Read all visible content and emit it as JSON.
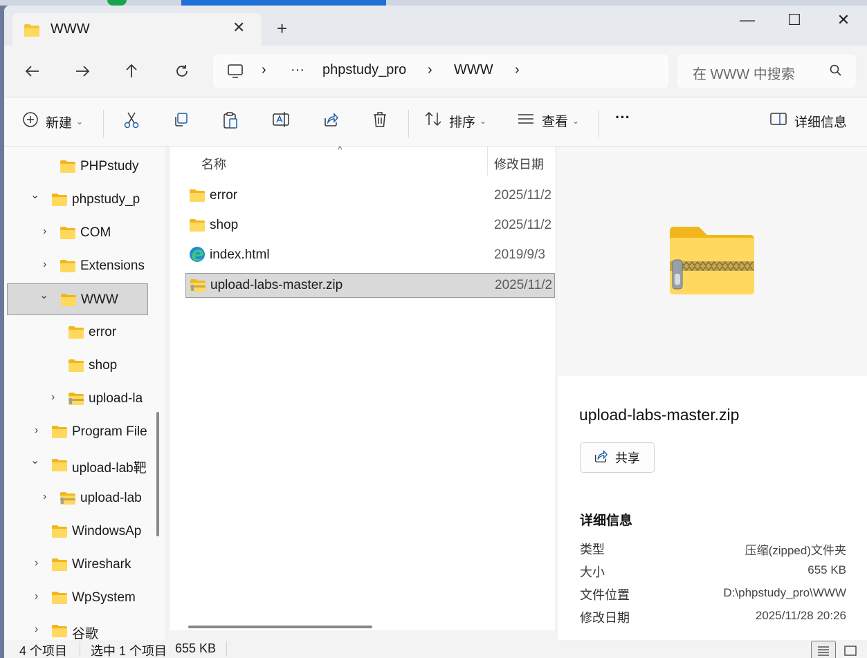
{
  "window": {
    "tab_title": "WWW",
    "tab_close": "✕",
    "new_tab": "+",
    "minimize": "—",
    "maximize": "☐",
    "close": "✕"
  },
  "address": {
    "ellipsis": "···",
    "segments": [
      "phpstudy_pro",
      "WWW"
    ],
    "separator": "›",
    "search_placeholder": "在 WWW 中搜索"
  },
  "toolbar": {
    "new_label": "新建",
    "sort_label": "排序",
    "view_label": "查看",
    "more_label": "···",
    "details_label": "详细信息"
  },
  "nav_tree": [
    {
      "label": "PHPstudy",
      "chevron": ""
    },
    {
      "label": "phpstudy_p",
      "chevron": "⌄"
    },
    {
      "label": "COM",
      "chevron": "›"
    },
    {
      "label": "Extensions",
      "chevron": "›"
    },
    {
      "label": "WWW",
      "chevron": "⌄",
      "selected": true
    },
    {
      "label": "error",
      "chevron": ""
    },
    {
      "label": "shop",
      "chevron": ""
    },
    {
      "label": "upload-la",
      "chevron": "›",
      "zip": true
    },
    {
      "label": "Program File",
      "chevron": "›"
    },
    {
      "label": "upload-lab靶",
      "chevron": "⌄"
    },
    {
      "label": "upload-lab",
      "chevron": "›",
      "zip": true
    },
    {
      "label": "WindowsAp",
      "chevron": ""
    },
    {
      "label": "Wireshark",
      "chevron": "›"
    },
    {
      "label": "WpSystem",
      "chevron": "›"
    },
    {
      "label": "谷歌",
      "chevron": "›"
    }
  ],
  "file_list": {
    "col_name": "名称",
    "col_date": "修改日期",
    "sort_arrow": "^",
    "rows": [
      {
        "name": "error",
        "date": "2025/11/2",
        "icon": "folder-icon"
      },
      {
        "name": "shop",
        "date": "2025/11/2",
        "icon": "folder-icon"
      },
      {
        "name": "index.html",
        "date": "2019/9/3",
        "icon": "edge-icon"
      },
      {
        "name": "upload-labs-master.zip",
        "date": "2025/11/2",
        "icon": "zip-folder-icon",
        "selected": true
      }
    ]
  },
  "details": {
    "file_name": "upload-labs-master.zip",
    "share_label": "共享",
    "section_title": "详细信息",
    "props": [
      {
        "key": "类型",
        "value": "压缩(zipped)文件夹"
      },
      {
        "key": "大小",
        "value": "655 KB"
      },
      {
        "key": "文件位置",
        "value": "D:\\phpstudy_pro\\WWW"
      },
      {
        "key": "修改日期",
        "value": "2025/11/28 20:26"
      }
    ]
  },
  "status": {
    "item_count": "4 个项目",
    "selection": "选中 1 个项目",
    "selection_size": "655 KB"
  },
  "colors": {
    "folder": "#f8c33c",
    "folder_light": "#ffd95e",
    "accent_blue": "#1f6fd6"
  }
}
